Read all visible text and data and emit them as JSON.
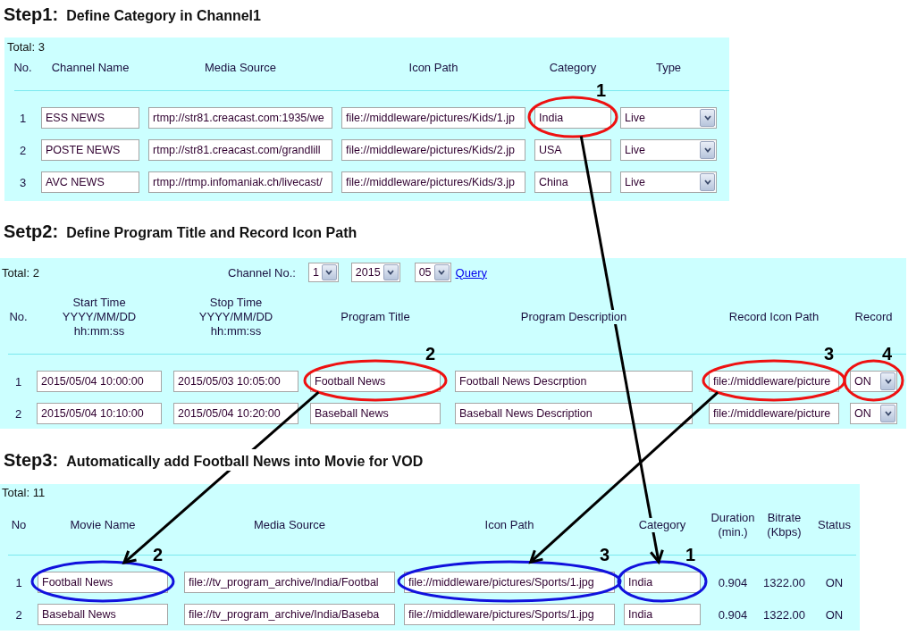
{
  "steps": [
    {
      "label": "Step1:",
      "title": "Define Category in Channel1",
      "total": "Total: 3",
      "columns": [
        {
          "label": "No.",
          "kind": "number"
        },
        {
          "label": "Channel Name",
          "kind": "input"
        },
        {
          "label": "Media Source",
          "kind": "input"
        },
        {
          "label": "Icon Path",
          "kind": "input"
        },
        {
          "label": "Category",
          "kind": "input"
        },
        {
          "label": "Type",
          "kind": "select"
        }
      ],
      "rows": [
        {
          "cells": [
            {
              "value": "1"
            },
            {
              "value": "ESS NEWS"
            },
            {
              "value": "rtmp://str81.creacast.com:1935/we"
            },
            {
              "value": "file://middleware/pictures/Kids/1.jp"
            },
            {
              "value": "India",
              "marker": {
                "label": "1",
                "color": "#ee1111",
                "kind": "source"
              }
            },
            {
              "value": "Live"
            }
          ]
        },
        {
          "cells": [
            {
              "value": "2"
            },
            {
              "value": "POSTE NEWS"
            },
            {
              "value": "rtmp://str81.creacast.com/grandlill"
            },
            {
              "value": "file://middleware/pictures/Kids/2.jp"
            },
            {
              "value": "USA"
            },
            {
              "value": "Live"
            }
          ]
        },
        {
          "cells": [
            {
              "value": "3"
            },
            {
              "value": "AVC NEWS"
            },
            {
              "value": "rtmp://rtmp.infomaniak.ch/livecast/"
            },
            {
              "value": "file://middleware/pictures/Kids/3.jp"
            },
            {
              "value": "China"
            },
            {
              "value": "Live"
            }
          ]
        }
      ]
    },
    {
      "label": "Setp2:",
      "title": "Define Program Title and Record Icon Path",
      "total": "Total: 2",
      "filters": [
        {
          "kind": "label",
          "text": "Channel No.:"
        },
        {
          "kind": "select",
          "value": "1"
        },
        {
          "kind": "select",
          "value": "2015"
        },
        {
          "kind": "select",
          "value": "05"
        },
        {
          "kind": "link",
          "text": "Query"
        }
      ],
      "columns": [
        {
          "label": "No.",
          "kind": "number"
        },
        {
          "label": "Start Time\nYYYY/MM/DD\nhh:mm:ss",
          "kind": "input"
        },
        {
          "label": "Stop Time\nYYYY/MM/DD\nhh:mm:ss",
          "kind": "input"
        },
        {
          "label": "Program Title",
          "kind": "input"
        },
        {
          "label": "Program Description",
          "kind": "input"
        },
        {
          "label": "Record Icon Path",
          "kind": "input"
        },
        {
          "label": "Record",
          "kind": "select"
        }
      ],
      "rows": [
        {
          "cells": [
            {
              "value": "1"
            },
            {
              "value": "2015/05/04 10:00:00"
            },
            {
              "value": "2015/05/03 10:05:00"
            },
            {
              "value": "Football News",
              "marker": {
                "label": "2",
                "color": "#ee1111",
                "kind": "source"
              }
            },
            {
              "value": "Football News Descrption"
            },
            {
              "value": "file://middleware/picture",
              "marker": {
                "label": "3",
                "color": "#ee1111",
                "kind": "source"
              }
            },
            {
              "value": "ON",
              "marker": {
                "label": "4",
                "color": "#ee1111",
                "kind": "source"
              }
            }
          ]
        },
        {
          "cells": [
            {
              "value": "2"
            },
            {
              "value": "2015/05/04 10:10:00"
            },
            {
              "value": "2015/05/04 10:20:00"
            },
            {
              "value": "Baseball News"
            },
            {
              "value": "Baseball News Description"
            },
            {
              "value": "file://middleware/picture"
            },
            {
              "value": "ON"
            }
          ]
        }
      ]
    },
    {
      "label": "Step3:",
      "title": "Automatically add Football News into Movie for VOD",
      "total": "Total: 11",
      "columns": [
        {
          "label": "No",
          "kind": "number"
        },
        {
          "label": "Movie Name",
          "kind": "input"
        },
        {
          "label": "Media Source",
          "kind": "input"
        },
        {
          "label": "Icon Path",
          "kind": "input"
        },
        {
          "label": "Category",
          "kind": "input"
        },
        {
          "label": "Duration\n(min.)",
          "kind": "text"
        },
        {
          "label": "Bitrate\n(Kbps)",
          "kind": "text"
        },
        {
          "label": "Status",
          "kind": "text"
        }
      ],
      "rows": [
        {
          "cells": [
            {
              "value": "1"
            },
            {
              "value": "Football News",
              "marker": {
                "label": "2",
                "color": "#1111dd",
                "kind": "target"
              }
            },
            {
              "value": "file://tv_program_archive/India/Footbal"
            },
            {
              "value": "file://middleware/pictures/Sports/1.jpg",
              "marker": {
                "label": "3",
                "color": "#1111dd",
                "kind": "target"
              }
            },
            {
              "value": "India",
              "marker": {
                "label": "1",
                "color": "#1111dd",
                "kind": "target"
              }
            },
            {
              "value": "0.904"
            },
            {
              "value": "1322.00"
            },
            {
              "value": "ON"
            }
          ]
        },
        {
          "cells": [
            {
              "value": "2"
            },
            {
              "value": "Baseball News"
            },
            {
              "value": "file://tv_program_archive/India/Baseba"
            },
            {
              "value": "file://middleware/pictures/Sports/1.jpg"
            },
            {
              "value": "India"
            },
            {
              "value": "0.904"
            },
            {
              "value": "1322.00"
            },
            {
              "value": "ON"
            }
          ]
        }
      ]
    }
  ]
}
